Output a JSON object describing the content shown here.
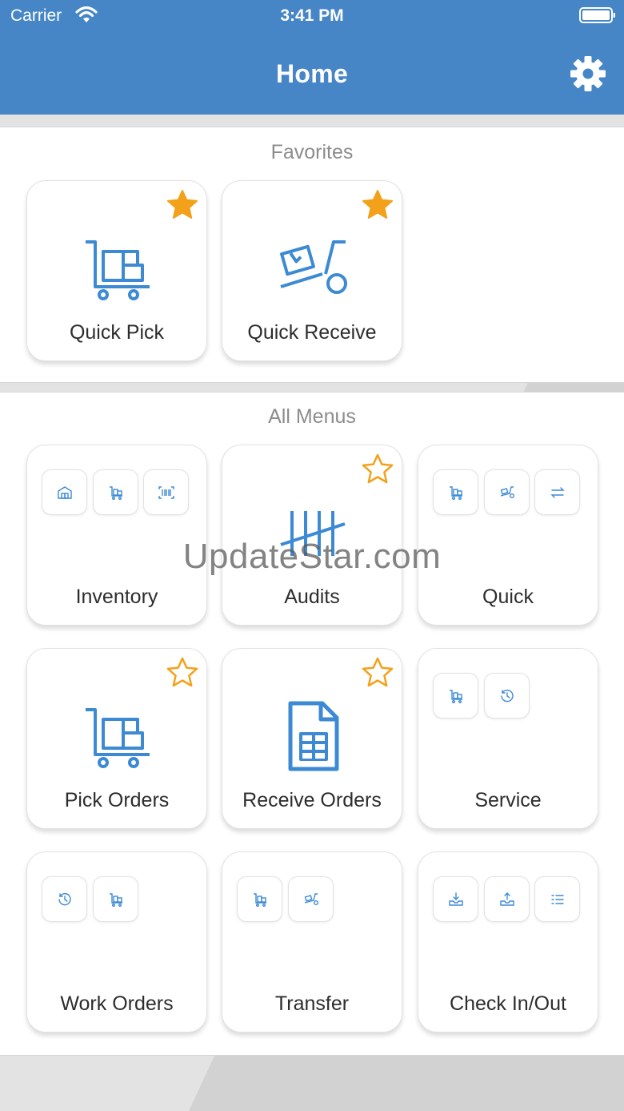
{
  "status_bar": {
    "carrier": "Carrier",
    "time": "3:41 PM"
  },
  "header": {
    "title": "Home"
  },
  "favorites": {
    "title": "Favorites",
    "tiles": [
      {
        "label": "Quick Pick",
        "icon": "cart-icon",
        "starred": true
      },
      {
        "label": "Quick Receive",
        "icon": "hand-truck-icon",
        "starred": true
      }
    ]
  },
  "all_menus": {
    "title": "All Menus",
    "tiles": [
      {
        "label": "Inventory",
        "icons": [
          "warehouse-icon",
          "cart-icon",
          "barcode-icon"
        ]
      },
      {
        "label": "Audits",
        "icon": "tally-icon",
        "starred": false
      },
      {
        "label": "Quick",
        "icons": [
          "cart-icon",
          "hand-truck-icon",
          "transfer-icon"
        ]
      },
      {
        "label": "Pick Orders",
        "icon": "cart-icon",
        "starred": false
      },
      {
        "label": "Receive Orders",
        "icon": "document-table-icon",
        "starred": false
      },
      {
        "label": "Service",
        "icons": [
          "cart-icon",
          "history-icon"
        ]
      },
      {
        "label": "Work Orders",
        "icons": [
          "history-icon",
          "cart-icon"
        ]
      },
      {
        "label": "Transfer",
        "icons": [
          "cart-icon",
          "hand-truck-icon"
        ]
      },
      {
        "label": "Check In/Out",
        "icons": [
          "check-in-icon",
          "check-out-icon",
          "list-icon"
        ]
      }
    ]
  },
  "watermark": "UpdateStar.com",
  "colors": {
    "header": "#4686c6",
    "icon_blue": "#3d8ad4",
    "star": "#f3a11a"
  }
}
